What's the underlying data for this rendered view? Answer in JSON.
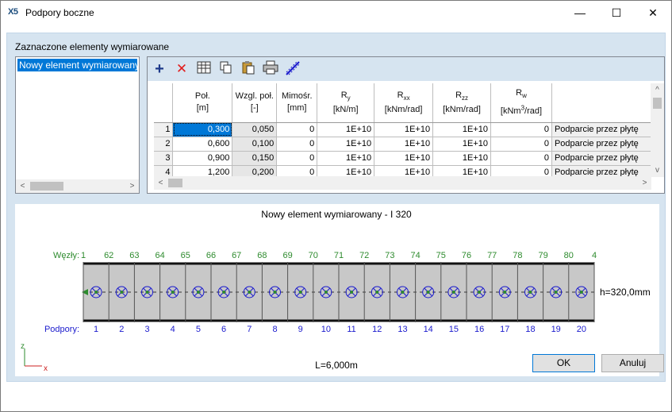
{
  "window": {
    "app_icon": "X5",
    "title": "Podpory boczne",
    "minimize_glyph": "—",
    "maximize_glyph": "☐",
    "close_glyph": "✕"
  },
  "panel": {
    "section_label": "Zaznaczone elementy wymiarowane",
    "list_items": [
      "Nowy element wymiarowany"
    ]
  },
  "toolbar": {
    "icons": [
      "add-icon",
      "delete-icon",
      "columns-icon",
      "copy-icon",
      "paste-icon",
      "print-icon",
      "distribute-icon"
    ],
    "add_color": "#1e3a8a",
    "delete_color": "#e11d1d"
  },
  "table": {
    "headers": [
      {
        "line1": "Poł.",
        "line2": "[m]"
      },
      {
        "line1": "Wzgl. poł.",
        "line2": "[-]"
      },
      {
        "line1": "Mimośr.",
        "line2": "[mm]"
      },
      {
        "line1": "Ry",
        "line2": "[kN/m]"
      },
      {
        "line1": "Rxx",
        "line2": "[kNm/rad]"
      },
      {
        "line1": "Rzz",
        "line2": "[kNm/rad]"
      },
      {
        "line1": "Rw",
        "line2": "[kNm3/rad]"
      },
      {
        "line1": "",
        "line2": ""
      }
    ],
    "rows": [
      {
        "n": "1",
        "pos": "0,300",
        "rel": "0,050",
        "ecc": "0",
        "ry": "1E+10",
        "rxx": "1E+10",
        "rzz": "1E+10",
        "rw": "0",
        "desc": "Podparcie przez płytę"
      },
      {
        "n": "2",
        "pos": "0,600",
        "rel": "0,100",
        "ecc": "0",
        "ry": "1E+10",
        "rxx": "1E+10",
        "rzz": "1E+10",
        "rw": "0",
        "desc": "Podparcie przez płytę"
      },
      {
        "n": "3",
        "pos": "0,900",
        "rel": "0,150",
        "ecc": "0",
        "ry": "1E+10",
        "rxx": "1E+10",
        "rzz": "1E+10",
        "rw": "0",
        "desc": "Podparcie przez płytę"
      },
      {
        "n": "4",
        "pos": "1,200",
        "rel": "0,200",
        "ecc": "0",
        "ry": "1E+10",
        "rxx": "1E+10",
        "rzz": "1E+10",
        "rw": "0",
        "desc": "Podparcie przez płytę"
      }
    ]
  },
  "diagram": {
    "title": "Nowy element wymiarowany - I 320",
    "nodes_label": "Węzły:",
    "nodes": [
      "1",
      "62",
      "63",
      "64",
      "65",
      "66",
      "67",
      "68",
      "69",
      "70",
      "71",
      "72",
      "73",
      "74",
      "75",
      "76",
      "77",
      "78",
      "79",
      "80",
      "4"
    ],
    "supports_label": "Podpory:",
    "supports": [
      "1",
      "2",
      "3",
      "4",
      "5",
      "6",
      "7",
      "8",
      "9",
      "10",
      "11",
      "12",
      "13",
      "14",
      "15",
      "16",
      "17",
      "18",
      "19",
      "20"
    ],
    "height_label": "h=320,0mm",
    "length_label": "L=6,000m",
    "axis_z": "z",
    "axis_x": "x",
    "node_color": "#2e8b2e",
    "support_color": "#1a1acd",
    "beam_color": "#c8c8c8"
  },
  "buttons": {
    "ok": "OK",
    "cancel": "Anuluj"
  }
}
